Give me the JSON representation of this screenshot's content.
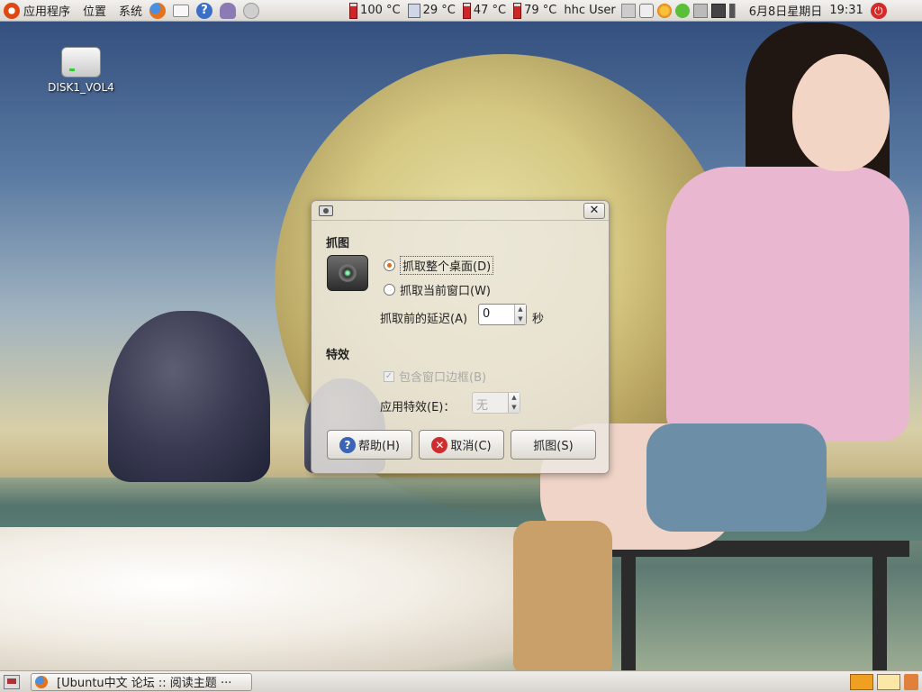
{
  "top_panel": {
    "menu_applications": "应用程序",
    "menu_places": "位置",
    "menu_system": "系统",
    "sensors": [
      {
        "value": "100 °C",
        "icon": "thermometer-red"
      },
      {
        "value": "29 °C",
        "icon": "hard-disk"
      },
      {
        "value": "47 °C",
        "icon": "thermometer-red"
      },
      {
        "value": "79 °C",
        "icon": "thermometer-red"
      }
    ],
    "user": "hhc User",
    "date": "6月8日星期日",
    "time": "19:31"
  },
  "desktop": {
    "icon_label": "DISK1_VOL4"
  },
  "dialog": {
    "section_grab": "抓图",
    "option_desktop": "抓取整个桌面(D)",
    "option_window": "抓取当前窗口(W)",
    "delay_label": "抓取前的延迟(A)",
    "delay_value": "0",
    "delay_unit": "秒",
    "section_effects": "特效",
    "include_border": "包含窗口边框(B)",
    "effect_label": "应用特效(E)：",
    "effect_value": "无",
    "help_button": "帮助(H)",
    "cancel_button": "取消(C)",
    "grab_button": "抓图(S)"
  },
  "bottom_panel": {
    "task_title": "[Ubuntu中文 论坛 :: 阅读主题 ···"
  },
  "colors": {
    "accent_orange": "#e36b1d",
    "panel_bg": "#e6e3de"
  }
}
